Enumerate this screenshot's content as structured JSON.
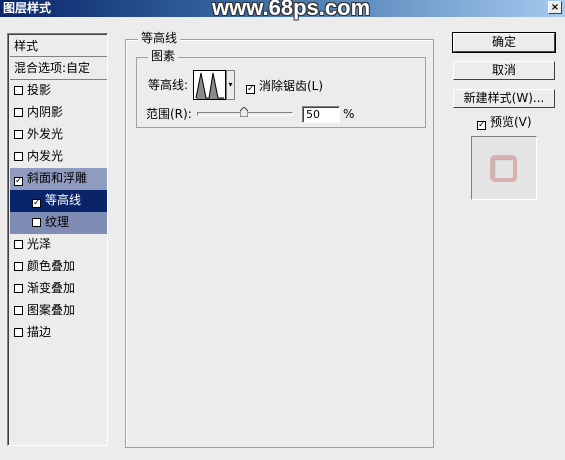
{
  "window": {
    "title": "图层样式",
    "watermark": "www.68ps.com",
    "close_label": "×"
  },
  "styles_panel": {
    "header": "样式",
    "blend_options": "混合选项:自定",
    "items": [
      {
        "label": "投影",
        "checked": false
      },
      {
        "label": "内阴影",
        "checked": false
      },
      {
        "label": "外发光",
        "checked": false
      },
      {
        "label": "内发光",
        "checked": false
      },
      {
        "label": "斜面和浮雕",
        "checked": true
      },
      {
        "label": "等高线",
        "checked": true
      },
      {
        "label": "纹理",
        "checked": false
      },
      {
        "label": "光泽",
        "checked": false
      },
      {
        "label": "颜色叠加",
        "checked": false
      },
      {
        "label": "渐变叠加",
        "checked": false
      },
      {
        "label": "图案叠加",
        "checked": false
      },
      {
        "label": "描边",
        "checked": false
      }
    ]
  },
  "contour_section": {
    "group_title": "等高线",
    "subgroup_title": "图素",
    "contour_label": "等高线:",
    "antialias_label": "消除锯齿(L)",
    "antialias_checked": true,
    "range_label": "范围(R):",
    "range_value": "50",
    "range_unit": "%"
  },
  "buttons": {
    "ok": "确定",
    "cancel": "取消",
    "new_style": "新建样式(W)...",
    "preview_label": "预览(V)",
    "preview_checked": true
  },
  "colors": {
    "selection_dark": "#0a246a",
    "selection_light": "#8f9bbf",
    "preview_shape": "#d8b0b0"
  }
}
